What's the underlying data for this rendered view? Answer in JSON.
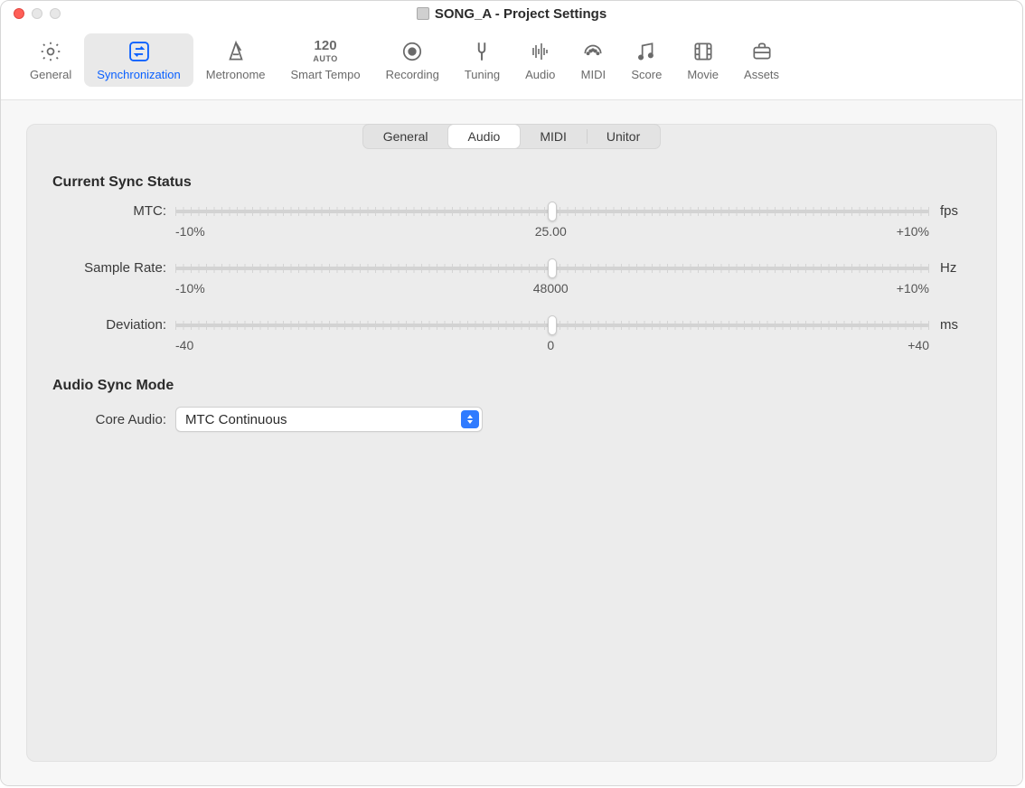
{
  "window": {
    "title": "SONG_A - Project Settings"
  },
  "toolbar": {
    "items": [
      {
        "label": "General",
        "icon": "gear"
      },
      {
        "label": "Synchronization",
        "icon": "sync",
        "selected": true
      },
      {
        "label": "Metronome",
        "icon": "metronome"
      },
      {
        "label": "Smart Tempo",
        "icon": "smart-tempo"
      },
      {
        "label": "Recording",
        "icon": "record"
      },
      {
        "label": "Tuning",
        "icon": "tuning-fork"
      },
      {
        "label": "Audio",
        "icon": "waveform"
      },
      {
        "label": "MIDI",
        "icon": "midi"
      },
      {
        "label": "Score",
        "icon": "notes"
      },
      {
        "label": "Movie",
        "icon": "film"
      },
      {
        "label": "Assets",
        "icon": "briefcase"
      }
    ]
  },
  "tabs": {
    "items": [
      "General",
      "Audio",
      "MIDI",
      "Unitor"
    ],
    "active": "Audio"
  },
  "sections": {
    "sync_status_title": "Current Sync Status",
    "audio_sync_mode_title": "Audio Sync Mode"
  },
  "sliders": {
    "mtc": {
      "label": "MTC:",
      "unit": "fps",
      "left": "-10%",
      "center": "25.00",
      "right": "+10%"
    },
    "samplerate": {
      "label": "Sample Rate:",
      "unit": "Hz",
      "left": "-10%",
      "center": "48000",
      "right": "+10%"
    },
    "deviation": {
      "label": "Deviation:",
      "unit": "ms",
      "left": "-40",
      "center": "0",
      "right": "+40"
    }
  },
  "core_audio": {
    "label": "Core Audio:",
    "value": "MTC Continuous"
  }
}
